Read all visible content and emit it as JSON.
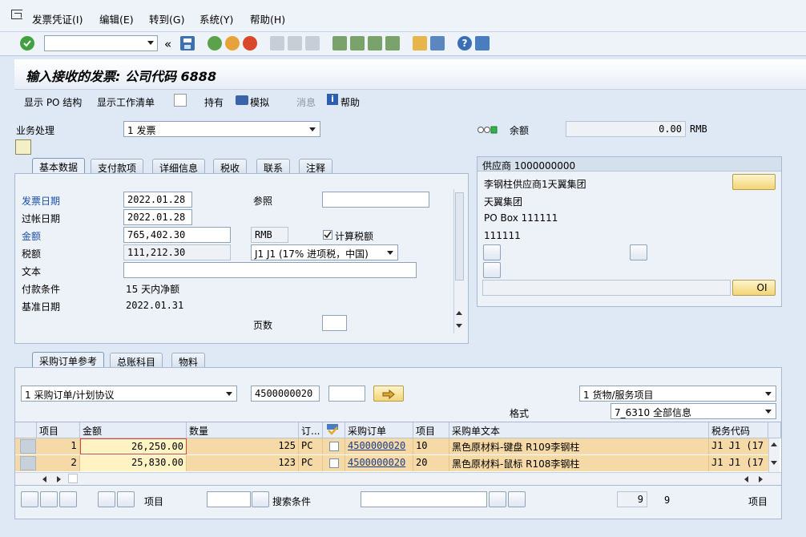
{
  "menu": {
    "items": [
      "发票凭证(I)",
      "编辑(E)",
      "转到(G)",
      "系统(Y)",
      "帮助(H)"
    ]
  },
  "toolbar": {
    "command_value": "",
    "back_symbol": "«"
  },
  "title": "输入接收的发票: 公司代码 6888",
  "app_toolbar": {
    "show_po_structure": "显示 PO 结构",
    "show_worklist": "显示工作清单",
    "hold": "持有",
    "simulate": "模拟",
    "messages": "消息",
    "help": "帮助"
  },
  "header": {
    "transaction_label": "业务处理",
    "transaction_value": "1 发票",
    "balance_label": "余额",
    "balance_value": "0.00",
    "balance_currency": "RMB"
  },
  "basic_tabs": [
    "基本数据",
    "支付款项",
    "详细信息",
    "税收",
    "联系",
    "注释"
  ],
  "basic_data": {
    "invoice_date_label": "发票日期",
    "invoice_date": "2022.01.28",
    "reference_label": "参照",
    "reference": "",
    "posting_date_label": "过帐日期",
    "posting_date": "2022.01.28",
    "amount_label": "金额",
    "amount": "765,402.30",
    "currency": "RMB",
    "calc_tax_label": "计算税额",
    "tax_label": "税额",
    "tax": "111,212.30",
    "tax_code": "J1 J1 (17% 进项税，中国)",
    "text_label": "文本",
    "text": "",
    "payment_terms_label": "付款条件",
    "payment_terms": "15 天内净额",
    "baseline_date_label": "基准日期",
    "baseline_date": "2022.01.31",
    "pages_label": "页数",
    "pages": ""
  },
  "vendor": {
    "header": "供应商 1000000000",
    "name": "李钢柱供应商1天翼集团",
    "line2": "天翼集团",
    "pobox": "PO Box 111111",
    "postcode": "111111",
    "search_field": "",
    "oi_label": "OI"
  },
  "ref_tabs": [
    "采购订单参考",
    "总账科目",
    "物料"
  ],
  "reference": {
    "doc_type": "1 采购订单/计划协议",
    "po_number": "4500000020",
    "po_item": "",
    "item_type": "1 货物/服务项目",
    "layout_label": "格式",
    "layout": "7_6310 全部信息"
  },
  "table": {
    "columns": [
      "项目",
      "金额",
      "数量",
      "订...",
      "",
      "采购订单",
      "项目",
      "采购单文本",
      "税务代码"
    ],
    "rows": [
      {
        "item": "1",
        "amount": "26,250.00",
        "qty": "125",
        "unit": "PC",
        "po": "4500000020",
        "po_item": "10",
        "text": "黑色原材料-键盘 R109李钢柱",
        "tax": "J1  J1  (17"
      },
      {
        "item": "2",
        "amount": "25,830.00",
        "qty": "123",
        "unit": "PC",
        "po": "4500000020",
        "po_item": "20",
        "text": "黑色原材料-鼠标 R108李钢柱",
        "tax": "J1  J1  (17"
      }
    ]
  },
  "footer": {
    "item_label": "项目",
    "item_value": "",
    "search_label": "搜索条件",
    "search_value": "",
    "count_field": "9",
    "count": "9",
    "items_label": "项目"
  }
}
